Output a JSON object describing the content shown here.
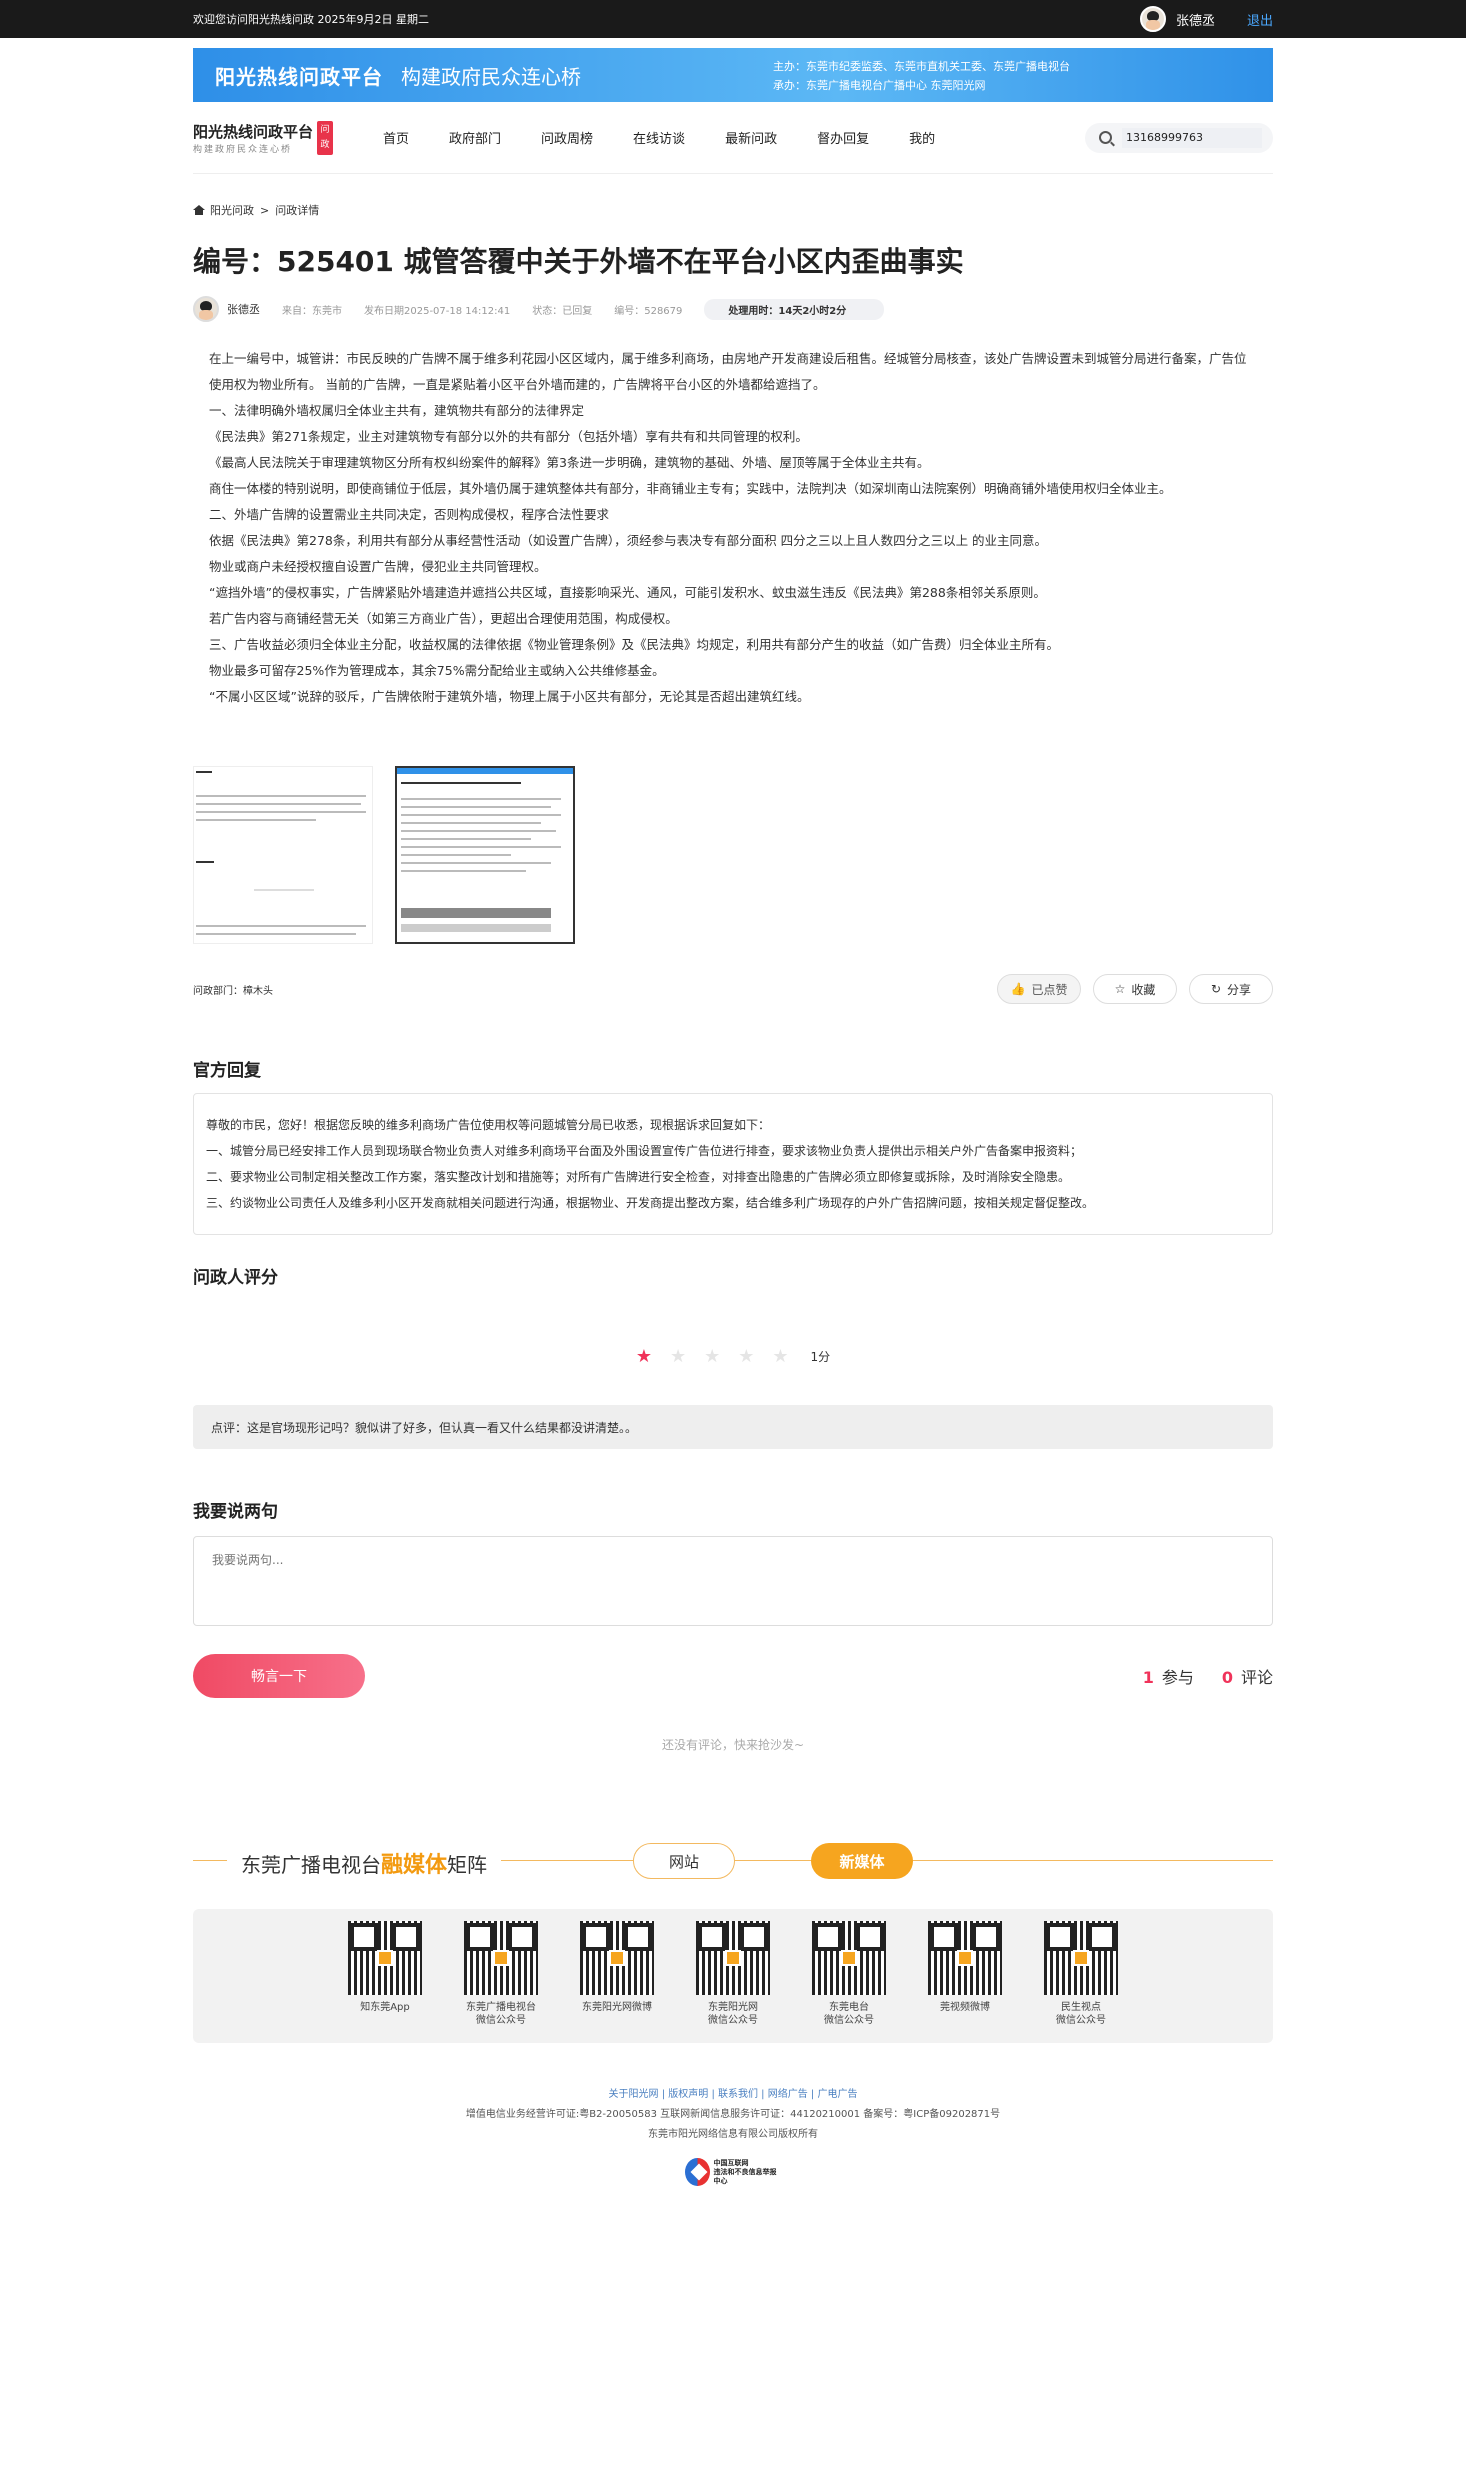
{
  "topbar": {
    "welcome": "欢迎您访问阳光热线问政 2025年9月2日 星期二",
    "username": "张德丞",
    "logout": "退出"
  },
  "banner": {
    "title": "阳光热线问政平台",
    "slogan": "构建政府民众连心桥",
    "host": "主办：东莞市纪委监委、东莞市直机关工委、东莞广播电视台",
    "organizer": "承办：东莞广播电视台广播中心 东莞阳光网"
  },
  "logo": {
    "title": "阳光热线问政平台",
    "subtitle": "构建政府民众连心桥",
    "seal": "问政"
  },
  "nav": {
    "items": [
      "首页",
      "政府部门",
      "问政周榜",
      "在线访谈",
      "最新问政",
      "督办回复",
      "我的"
    ]
  },
  "search": {
    "value": "13168999763"
  },
  "breadcrumb": {
    "home": "阳光问政",
    "sep": ">",
    "current": "问政详情"
  },
  "question": {
    "title": "编号：525401 城管答覆中关于外墙不在平台小区内歪曲事实",
    "author": "张德丞",
    "source": "来自：东莞市",
    "date": "发布日期2025-07-18 14:12:41",
    "status": "状态：已回复",
    "number": "编号：528679",
    "timer": "处理用时：14天2小时2分",
    "paragraphs": [
      "在上一编号中，城管讲：市民反映的广告牌不属于维多利花园小区区域内，属于维多利商场，由房地产开发商建设后租售。经城管分局核查，该处广告牌设置未到城管分局进行备案，广告位使用权为物业所有。 当前的广告牌，一直是紧贴着小区平台外墙而建的，广告牌将平台小区的外墙都给遮挡了。",
      "一、法律明确外墙权属归全体业主共有，建筑物共有部分的法律界定",
      "《民法典》第271条规定，业主对建筑物专有部分以外的共有部分（包括外墙）享有共有和共同管理的权利。",
      "《最高人民法院关于审理建筑物区分所有权纠纷案件的解释》第3条进一步明确，建筑物的基础、外墙、屋顶等属于全体业主共有。",
      "商住一体楼的特别说明，即使商铺位于低层，其外墙仍属于建筑整体共有部分，非商铺业主专有；实践中，法院判决（如深圳南山法院案例）明确商铺外墙使用权归全体业主。",
      "二、外墙广告牌的设置需业主共同决定，否则构成侵权，程序合法性要求",
      "依据《民法典》第278条，利用共有部分从事经营性活动（如设置广告牌），须经参与表决专有部分面积 四分之三以上且人数四分之三以上 的业主同意。",
      "物业或商户未经授权擅自设置广告牌，侵犯业主共同管理权。",
      "“遮挡外墙”的侵权事实，广告牌紧贴外墙建造并遮挡公共区域，直接影响采光、通风，可能引发积水、蚊虫滋生违反《民法典》第288条相邻关系原则。",
      "若广告内容与商铺经营无关（如第三方商业广告），更超出合理使用范围，构成侵权。",
      "三、广告收益必须归全体业主分配，收益权属的法律依据《物业管理条例》及《民法典》均规定，利用共有部分产生的收益（如广告费）归全体业主所有。",
      "物业最多可留存25%作为管理成本，其余75%需分配给业主或纳入公共维修基金。",
      "“不属小区区域”说辞的驳斥，广告牌依附于建筑外墙，物理上属于小区共有部分，无论其是否超出建筑红线。"
    ],
    "dept": "问政部门：樟木头",
    "liked": "已点赞",
    "collect": "收藏",
    "share": "分享"
  },
  "reply": {
    "heading": "官方回复",
    "lines": [
      "尊敬的市民，您好！根据您反映的维多利商场广告位使用权等问题城管分局已收悉，现根据诉求回复如下：",
      "一、城管分局已经安排工作人员到现场联合物业负责人对维多利商场平台面及外围设置宣传广告位进行排查，要求该物业负责人提供出示相关户外广告备案申报资料；",
      "二、要求物业公司制定相关整改工作方案，落实整改计划和措施等；对所有广告牌进行安全检查，对排查出隐患的广告牌必须立即修复或拆除，及时消除安全隐患。",
      "三、约谈物业公司责任人及维多利小区开发商就相关问题进行沟通，根据物业、开发商提出整改方案，结合维多利广场现存的户外广告招牌问题，按相关规定督促整改。"
    ]
  },
  "rating": {
    "heading": "问政人评分",
    "score": 1,
    "max": 5,
    "score_label": "1分",
    "comment": "点评：这是官场现形记吗？貌似讲了好多，但认真一看又什么结果都没讲清楚。。"
  },
  "comment_form": {
    "heading": "我要说两句",
    "placeholder": "我要说两句...",
    "submit": "畅言一下",
    "participants": "1",
    "participants_label": "参与",
    "comments": "0",
    "comments_label": "评论",
    "empty": "还没有评论，快来抢沙发~"
  },
  "matrix": {
    "title_a": "东莞广播电视台",
    "title_b": "融媒体",
    "title_c": "矩阵",
    "tab_web": "网站",
    "tab_new": "新媒体",
    "items": [
      [
        "知东莞App",
        ""
      ],
      [
        "东莞广播电视台",
        "微信公众号"
      ],
      [
        "东莞阳光网微博",
        ""
      ],
      [
        "东莞阳光网",
        "微信公众号"
      ],
      [
        "东莞电台",
        "微信公众号"
      ],
      [
        "莞视频微博",
        ""
      ],
      [
        "民生视点",
        "微信公众号"
      ]
    ]
  },
  "footer": {
    "links": "关于阳光网 | 版权声明 | 联系我们 | 网络广告 | 广电广告",
    "license": "增值电信业务经营许可证:粤B2-20050583 互联网新闻信息服务许可证：44120210001 备案号：粤ICP备09202871号",
    "copyright": "东莞市阳光网络信息有限公司版权所有",
    "badge_a": "中国互联网",
    "badge_b": "违法和不良信息举报中心"
  },
  "colors": {
    "accent": "#f0335a",
    "brand_blue": "#2e8fe8",
    "matrix_orange": "#f6a51f"
  }
}
